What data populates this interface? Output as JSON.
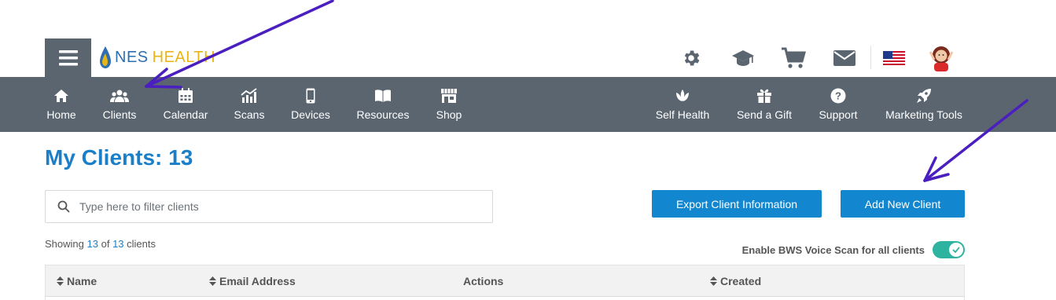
{
  "header": {
    "logo": {
      "brand_primary": "NES",
      "brand_secondary": "HEALTH"
    },
    "top_icons": [
      "gear-icon",
      "graduation-cap-icon",
      "cart-icon",
      "mail-icon",
      "us-flag-icon",
      "avatar"
    ]
  },
  "nav": {
    "left": [
      {
        "label": "Home",
        "icon": "home-icon"
      },
      {
        "label": "Clients",
        "icon": "users-icon"
      },
      {
        "label": "Calendar",
        "icon": "calendar-icon"
      },
      {
        "label": "Scans",
        "icon": "chart-icon"
      },
      {
        "label": "Devices",
        "icon": "phone-icon"
      },
      {
        "label": "Resources",
        "icon": "book-icon"
      },
      {
        "label": "Shop",
        "icon": "store-icon"
      }
    ],
    "right": [
      {
        "label": "Self Health",
        "icon": "lotus-icon"
      },
      {
        "label": "Send a Gift",
        "icon": "gift-icon"
      },
      {
        "label": "Support",
        "icon": "question-icon"
      },
      {
        "label": "Marketing Tools",
        "icon": "rocket-icon"
      }
    ]
  },
  "main": {
    "title": "My Clients: 13",
    "search": {
      "placeholder": "Type here to filter clients",
      "value": ""
    },
    "buttons": {
      "export": "Export Client Information",
      "add": "Add New Client"
    },
    "showing": {
      "prefix": "Showing",
      "shown": "13",
      "of": "of",
      "total": "13",
      "suffix": "clients"
    },
    "voice_scan": {
      "label": "Enable BWS Voice Scan for all clients",
      "enabled": true
    },
    "table": {
      "columns": [
        "Name",
        "Email Address",
        "Actions",
        "Created"
      ]
    }
  },
  "colors": {
    "nav_bg": "#5a6570",
    "accent": "#1386d0",
    "title": "#1a7fc8",
    "toggle_on": "#2eb3a0",
    "annotation_arrow": "#4b1fbf"
  }
}
